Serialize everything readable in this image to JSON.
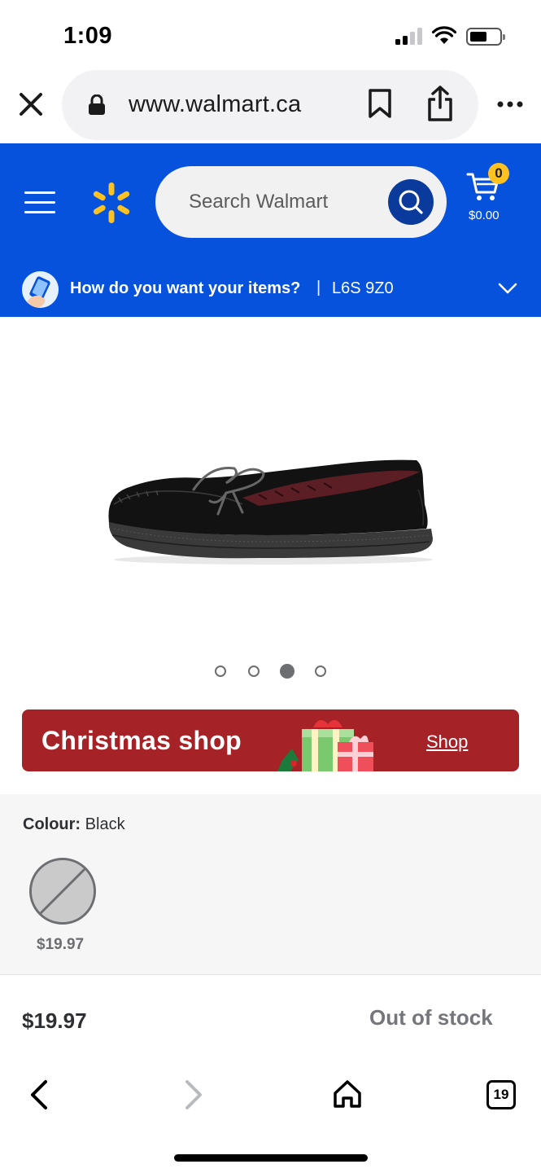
{
  "status_bar": {
    "time": "1:09",
    "signal_icon": "cellular-signal-icon",
    "wifi_icon": "wifi-icon",
    "battery_icon": "battery-icon"
  },
  "browser": {
    "url": "www.walmart.ca",
    "close_icon": "close-icon",
    "lock_icon": "lock-icon",
    "bookmark_icon": "bookmark-icon",
    "share_icon": "share-icon",
    "more_icon": "more-icon"
  },
  "header": {
    "search_placeholder": "Search Walmart",
    "cart_count": "0",
    "cart_total": "$0.00",
    "brand_color": "#0652dd",
    "spark_color": "#ffc220"
  },
  "delivery": {
    "question": "How do you want your items?",
    "separator": "|",
    "postal_code": "L6S 9Z0"
  },
  "product": {
    "image_icon": "moccasin-slipper-image",
    "carousel": {
      "total": 4,
      "active_index": 2
    }
  },
  "promo_banner": {
    "title": "Christmas shop",
    "link_label": "Shop",
    "color": "#a52226"
  },
  "variant": {
    "label": "Colour:",
    "value": "Black",
    "swatch_price": "$19.97"
  },
  "buy_bar": {
    "price": "$19.97",
    "status": "Out of stock"
  },
  "bottom_nav": {
    "back_icon": "back-arrow-icon",
    "forward_icon": "forward-arrow-icon",
    "home_icon": "home-icon",
    "tab_count": "19"
  }
}
